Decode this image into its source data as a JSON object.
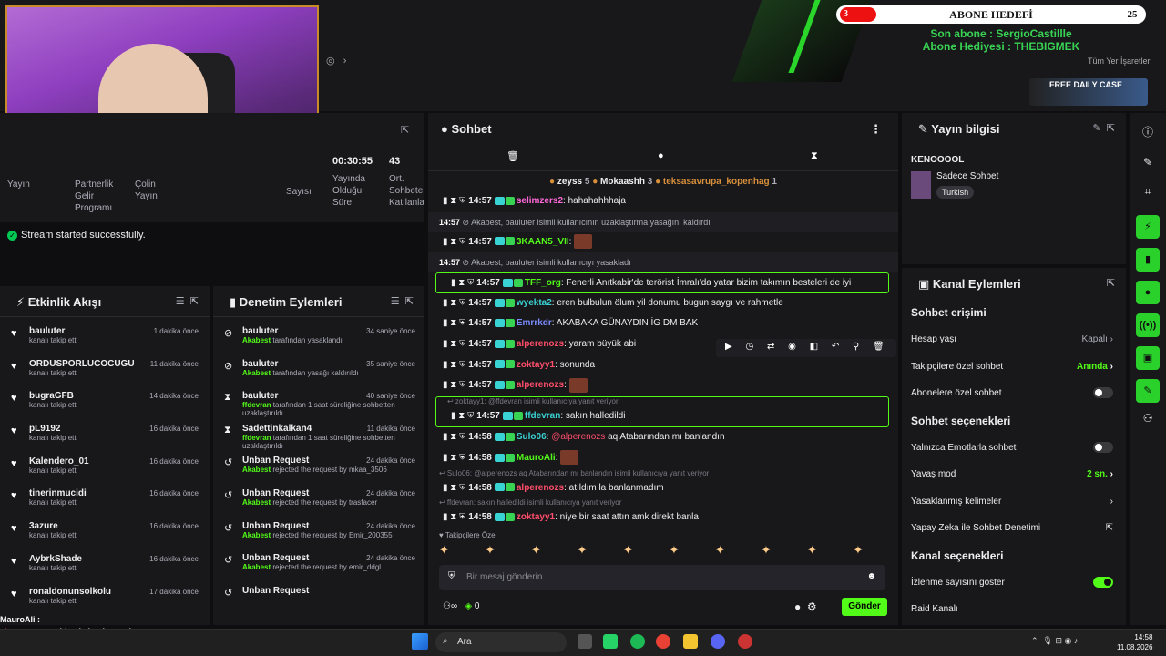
{
  "overlay": {
    "abone_title": "ABONE HEDEFİ",
    "abone_count": "3",
    "abone_goal": "25",
    "son_abone": "Son abone : SergioCastillle",
    "abone_hediyesi": "Abone Hediyesi : THEBIGMEK",
    "tum_yer": "Tüm Yer İşaretleri",
    "free_case": "FREE DAILY CASE"
  },
  "stats": {
    "time": "00:30:55",
    "viewers": "43",
    "l1": "Yayın",
    "l2": "Partnerlik Gelir Programı",
    "l3": "Çolin Yayın",
    "l4": "Yayında Olduğu Süre",
    "l5": "Ort. Sohbete Katılanla",
    "l6": "Sayısı"
  },
  "toast": "Stream started successfully.",
  "feed": {
    "title": "Etkinlik Akışı",
    "items": [
      {
        "name": "bauluter",
        "sub": "kanalı takip etti",
        "time": "1 dakika önce"
      },
      {
        "name": "ORDUSPORLUCOCUGU",
        "sub": "kanalı takip etti",
        "time": "11 dakika önce"
      },
      {
        "name": "bugraGFB",
        "sub": "kanalı takip etti",
        "time": "14 dakika önce"
      },
      {
        "name": "pL9192",
        "sub": "kanalı takip etti",
        "time": "16 dakika önce"
      },
      {
        "name": "Kalendero_01",
        "sub": "kanalı takip etti",
        "time": "16 dakika önce"
      },
      {
        "name": "tinerinmucidi",
        "sub": "kanalı takip etti",
        "time": "16 dakika önce"
      },
      {
        "name": "3azure",
        "sub": "kanalı takip etti",
        "time": "16 dakika önce"
      },
      {
        "name": "AybrkShade",
        "sub": "kanalı takip etti",
        "time": "16 dakika önce"
      },
      {
        "name": "ronaldonunsolkolu",
        "sub": "kanalı takip etti",
        "time": "17 dakika önce"
      }
    ]
  },
  "mod": {
    "title": "Denetim Eylemleri",
    "items": [
      {
        "name": "bauluter",
        "actor": "Akabest",
        "sub": " tarafından yasaklandı",
        "time": "34 saniye önce",
        "icon": "⊘"
      },
      {
        "name": "bauluter",
        "actor": "Akabest",
        "sub": " tarafından yasağı kaldırıldı",
        "time": "35 saniye önce",
        "icon": "⊘"
      },
      {
        "name": "bauluter",
        "actor": "ffdevran",
        "sub": " tarafından 1 saat süreliğine sohbetten uzaklaştırıldı",
        "time": "40 saniye önce",
        "icon": "⧗"
      },
      {
        "name": "Sadettinkalkan4",
        "actor": "ffdevran",
        "sub": " tarafından 1 saat süreliğine sohbetten uzaklaştırıldı",
        "time": "11 dakika önce",
        "icon": "⧗"
      },
      {
        "name": "Unban Request",
        "actor": "Akabest",
        "sub": " rejected the request by mkaa_3506",
        "time": "24 dakika önce",
        "icon": "↺"
      },
      {
        "name": "Unban Request",
        "actor": "Akabest",
        "sub": " rejected the request by trasfacer",
        "time": "24 dakika önce",
        "icon": "↺"
      },
      {
        "name": "Unban Request",
        "actor": "Akabest",
        "sub": " rejected the request by Emir_200355",
        "time": "24 dakika önce",
        "icon": "↺"
      },
      {
        "name": "Unban Request",
        "actor": "Akabest",
        "sub": " rejected the request by emir_ddgl",
        "time": "24 dakika önce",
        "icon": "↺"
      },
      {
        "name": "Unban Request",
        "actor": "",
        "sub": "",
        "time": "",
        "icon": "↺"
      }
    ]
  },
  "chat": {
    "title": "Sohbet",
    "pinned": [
      {
        "name": "zeyss",
        "n": "5"
      },
      {
        "name": "Mokaashh",
        "n": "3"
      },
      {
        "name": "teksasavrupa_kopenhag",
        "n": "1"
      }
    ],
    "rows": [
      {
        "k": "m",
        "time": "14:57",
        "user": "selimzers2",
        "color": "#ff69d9",
        "text": ": hahahahhhaja"
      },
      {
        "k": "s",
        "time": "14:57",
        "text": "Akabest, bauluter isimli kullanıcının uzaklaştırma yasağını kaldırdı"
      },
      {
        "k": "m",
        "time": "14:57",
        "user": "3KAAN5_VII",
        "color": "#53fc18",
        "text": ":",
        "emote": true
      },
      {
        "k": "s",
        "time": "14:57",
        "text": "Akabest, bauluter isimli kullanıcıyı yasakladı"
      },
      {
        "k": "h",
        "time": "14:57",
        "user": "TFF_org",
        "color": "#53fc18",
        "text": ": Fenerli Anıtkabir'de terörist İmralı'da yatar bizim takımın besteleri de iyi"
      },
      {
        "k": "m",
        "time": "14:57",
        "user": "wyekta2",
        "color": "#3ad3d3",
        "text": ": eren bulbulun ölum yil donumu bugun saygı ve rahmetle"
      },
      {
        "k": "m",
        "time": "14:57",
        "user": "Emrrkdr",
        "color": "#7b8cff",
        "text": ": AKABAKA GÜNAYDIN İG DM BAK"
      },
      {
        "k": "m",
        "time": "14:57",
        "user": "alperenozs",
        "color": "#ff4d6a",
        "text": ": yaram büyük abi"
      },
      {
        "k": "m",
        "time": "14:57",
        "user": "zoktayy1",
        "color": "#ff4d6a",
        "text": ": sonunda"
      },
      {
        "k": "m",
        "time": "14:57",
        "user": "alperenozs",
        "color": "#ff4d6a",
        "text": ":",
        "emote": true
      },
      {
        "k": "r",
        "reply": "zoktayy1: @ffdevran isimli kullanıcıya yanıt veriyor",
        "time": "14:57",
        "user": "ffdevran",
        "color": "#3ad3d3",
        "text": ": sakın halledildi"
      },
      {
        "k": "m",
        "time": "14:58",
        "user": "Sulo06",
        "color": "#3ad3d3",
        "text": ": @alperenozs aq Atabarından mı banlandın",
        "mention": true
      },
      {
        "k": "m",
        "time": "14:58",
        "user": "MauroAli",
        "color": "#53fc18",
        "text": ":",
        "emote": true
      },
      {
        "k": "r2",
        "reply": "Sulo06: @alperenozs aq Atabarından mı banlandın isimli kullanıcıya yanıt veriyor",
        "time": "14:58",
        "user": "alperenozs",
        "color": "#ff4d6a",
        "text": ": atıldım la banlanmadım"
      },
      {
        "k": "r2",
        "reply": "ffdevran: sakın halledildi isimli kullanıcıya yanıt veriyor",
        "time": "14:58",
        "user": "zoktayy1",
        "color": "#ff4d6a",
        "text": ": niye bir saat attın amk direkt banla"
      }
    ],
    "emote_label": "Takipçilere Özel",
    "placeholder": "Bir mesaj gönderin",
    "points": "0",
    "send": "Gönder"
  },
  "info": {
    "title": "Yayın bilgisi",
    "stream_title": "KENOOOOL",
    "category": "Sadece Sohbet",
    "tag": "Turkish"
  },
  "actions": {
    "title": "Kanal Eylemleri",
    "s1": "Sohbet erişimi",
    "hesap": "Hesap yaşı",
    "hesap_v": "Kapalı",
    "takip": "Takipçilere özel sohbet",
    "takip_v": "Anında",
    "abone": "Abonelere özel sohbet",
    "s2": "Sohbet seçenekleri",
    "emote": "Yalnızca Emotlarla sohbet",
    "yavas": "Yavaş mod",
    "yavas_v": "2 sn.",
    "yasak": "Yasaklanmış kelimeler",
    "yz": "Yapay Zeka ile Sohbet Denetimi",
    "s3": "Kanal seçenekleri",
    "izlenme": "İzlenme sayısını göster",
    "raid": "Raid Kanalı"
  },
  "bottom_overlay": [
    {
      "u": "MauroAli",
      "t": " : "
    },
    {
      "u": "alperenozs",
      "t": " : atıldım la banlanmadım"
    },
    {
      "u": "zoktayy1",
      "t": " : niye bir saat attın amk direkt banla"
    }
  ],
  "taskbar": {
    "search": "Ara",
    "time": "14:58",
    "date": "11.08.2026"
  }
}
